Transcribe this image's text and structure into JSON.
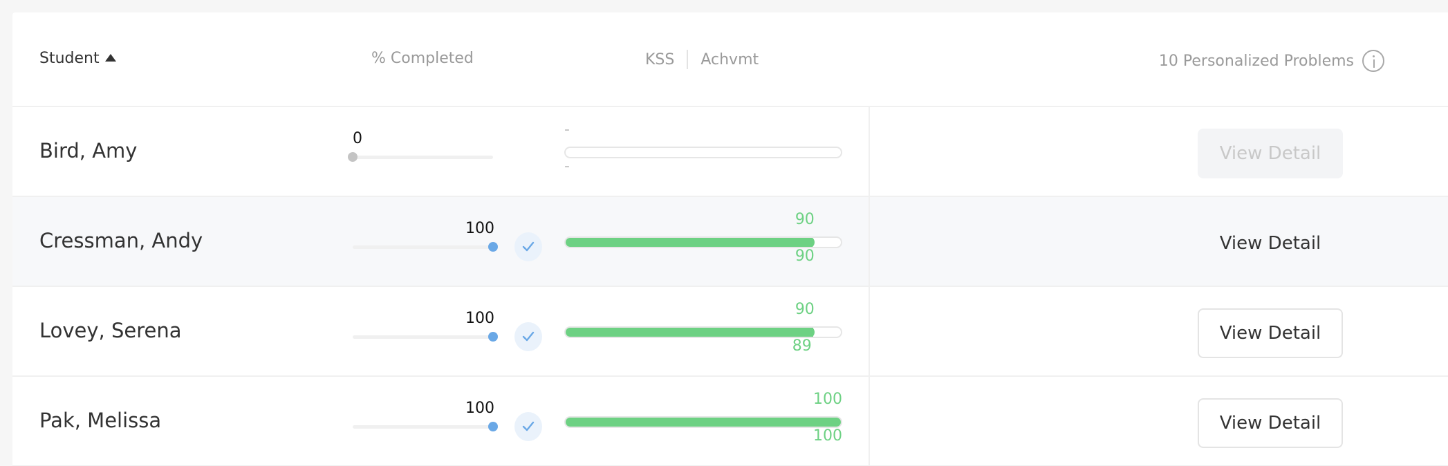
{
  "header": {
    "student_label": "Student",
    "sort_direction": "ascending",
    "completed_label": "% Completed",
    "kss_label": "KSS",
    "achvmt_label": "Achvmt",
    "problems_label": "10 Personalized Problems"
  },
  "colors": {
    "progress_green": "#6dd183",
    "completed_blue": "#6aa8e6",
    "zero_gray": "#c4c4c4",
    "hover_row": "#f7f8fa"
  },
  "rows": [
    {
      "name": "Bird, Amy",
      "completed": 0,
      "completed_label": "0",
      "completed_check": false,
      "kss": null,
      "achvmt": null,
      "kss_label": "-",
      "achvmt_label": "-",
      "button_label": "View Detail",
      "button_state": "disabled",
      "hovered": false
    },
    {
      "name": "Cressman, Andy",
      "completed": 100,
      "completed_label": "100",
      "completed_check": true,
      "kss": 90,
      "achvmt": 90,
      "kss_label": "90",
      "achvmt_label": "90",
      "button_label": "View Detail",
      "button_state": "hover",
      "hovered": true
    },
    {
      "name": "Lovey, Serena",
      "completed": 100,
      "completed_label": "100",
      "completed_check": true,
      "kss": 90,
      "achvmt": 89,
      "kss_label": "90",
      "achvmt_label": "89",
      "button_label": "View Detail",
      "button_state": "normal",
      "hovered": false
    },
    {
      "name": "Pak, Melissa",
      "completed": 100,
      "completed_label": "100",
      "completed_check": true,
      "kss": 100,
      "achvmt": 100,
      "kss_label": "100",
      "achvmt_label": "100",
      "button_label": "View Detail",
      "button_state": "normal",
      "hovered": false
    }
  ]
}
